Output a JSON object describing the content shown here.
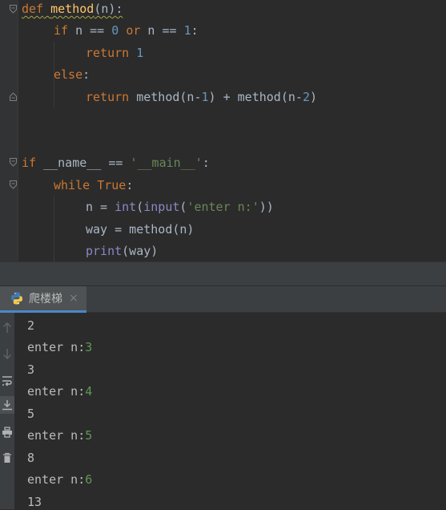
{
  "editor": {
    "line1": {
      "kw_def": "def",
      "fn_name": "method",
      "rest": "(n):"
    },
    "line2": {
      "kw_if": "if",
      "a": " n == ",
      "zero": "0",
      "kw_or": "or",
      "b": " n == ",
      "one": "1",
      "c": ":"
    },
    "line3": {
      "kw_return": "return",
      "one": "1"
    },
    "line4": {
      "kw_else": "else",
      "colon": ":"
    },
    "line5": {
      "kw_return": "return",
      "a": " method(n-",
      "one": "1",
      "b": ") + method(n-",
      "two": "2",
      "c": ")"
    },
    "line6": {
      "kw_if": "if",
      "dunder": " __name__ == ",
      "str": "'__main__'",
      "colon": ":"
    },
    "line7": {
      "kw_while": "while",
      "kw_true": "True",
      "colon": ":"
    },
    "line8": {
      "a": "n = ",
      "int": "int",
      "p1": "(",
      "input": "input",
      "p2": "(",
      "str": "'enter n:'",
      "p3": "))"
    },
    "line9": {
      "text": "way = method(n)"
    },
    "line10": {
      "print": "print",
      "rest": "(way)"
    }
  },
  "run_panel": {
    "tab_label": "爬楼梯",
    "tab_close": "×",
    "output": [
      {
        "text": "2",
        "input": ""
      },
      {
        "text": "enter n:",
        "input": "3"
      },
      {
        "text": "3",
        "input": ""
      },
      {
        "text": "enter n:",
        "input": "4"
      },
      {
        "text": "5",
        "input": ""
      },
      {
        "text": "enter n:",
        "input": "5"
      },
      {
        "text": "8",
        "input": ""
      },
      {
        "text": "enter n:",
        "input": "6"
      },
      {
        "text": "13",
        "input": ""
      }
    ]
  },
  "icons": {
    "tab": "python-icon",
    "toolbar": [
      "arrow-up-icon",
      "arrow-down-icon",
      "soft-wrap-icon",
      "scroll-to-end-icon",
      "print-icon",
      "trash-icon"
    ]
  },
  "colors": {
    "keyword": "#cc7832",
    "function": "#ffc66d",
    "number": "#6897bb",
    "string": "#6a8759",
    "builtin": "#8888c6",
    "user_input": "#629755"
  }
}
